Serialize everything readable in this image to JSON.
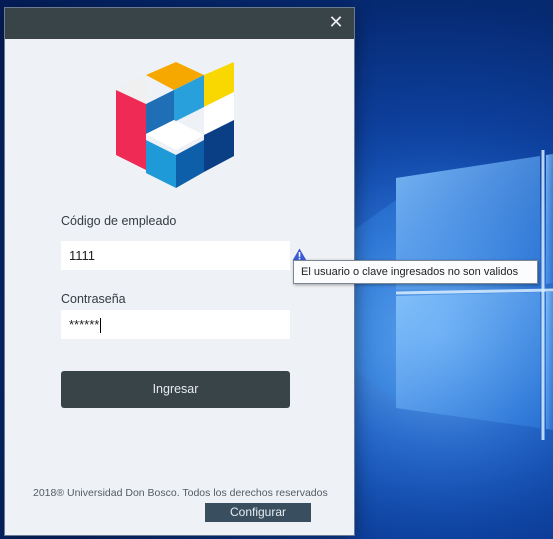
{
  "window": {
    "close_icon": "close-icon"
  },
  "form": {
    "employee_code_label": "Código de empleado",
    "employee_code_value": "1111",
    "password_label": "Contraseña",
    "password_value": "******",
    "error_tooltip": "El usuario o clave ingresados no son validos",
    "login_button": "Ingresar"
  },
  "footer": {
    "copyright": "2018® Universidad Don Bosco. Todos los derechos reservados",
    "config_button": "Configurar"
  },
  "colors": {
    "titlebar": "#394449",
    "dialog_bg": "#eef1f5",
    "button": "#394449",
    "warning": "#3c5bd6"
  }
}
